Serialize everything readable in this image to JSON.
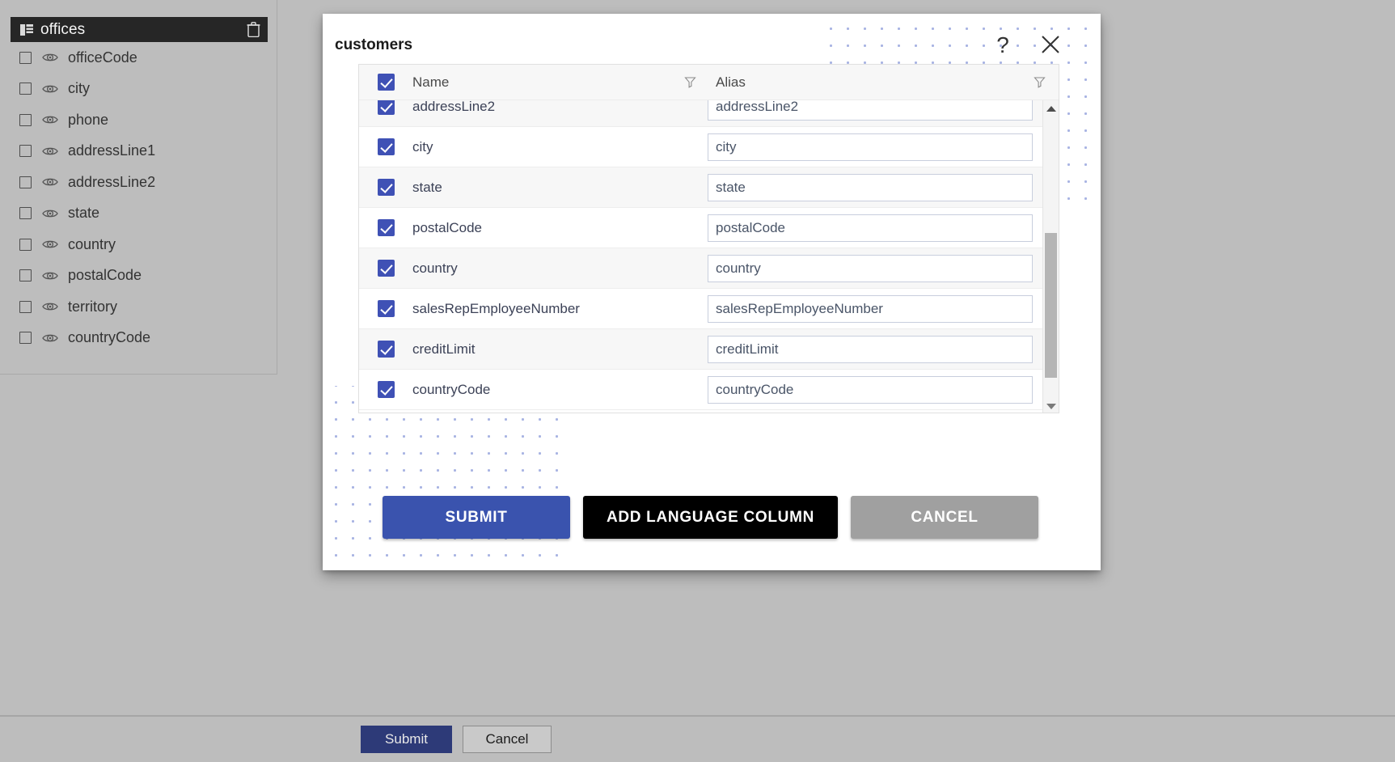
{
  "left_panel": {
    "table_title": "offices",
    "table_icon": "grid-icon",
    "delete_icon": "trash-icon",
    "fields": [
      {
        "label": "officeCode",
        "checked": false
      },
      {
        "label": "city",
        "checked": false
      },
      {
        "label": "phone",
        "checked": false
      },
      {
        "label": "addressLine1",
        "checked": false
      },
      {
        "label": "addressLine2",
        "checked": false
      },
      {
        "label": "state",
        "checked": false
      },
      {
        "label": "country",
        "checked": false
      },
      {
        "label": "postalCode",
        "checked": false
      },
      {
        "label": "territory",
        "checked": false
      },
      {
        "label": "countryCode",
        "checked": false
      }
    ]
  },
  "dialog": {
    "title": "customers",
    "help_icon": "?",
    "close_icon": "close-icon",
    "columns": {
      "name": "Name",
      "alias": "Alias",
      "filter_icon": "funnel-icon"
    },
    "header_checkbox_checked": true,
    "rows": [
      {
        "name": "addressLine2",
        "alias": "addressLine2",
        "checked": true
      },
      {
        "name": "city",
        "alias": "city",
        "checked": true
      },
      {
        "name": "state",
        "alias": "state",
        "checked": true
      },
      {
        "name": "postalCode",
        "alias": "postalCode",
        "checked": true
      },
      {
        "name": "country",
        "alias": "country",
        "checked": true
      },
      {
        "name": "salesRepEmployeeNumber",
        "alias": "salesRepEmployeeNumber",
        "checked": true
      },
      {
        "name": "creditLimit",
        "alias": "creditLimit",
        "checked": true
      },
      {
        "name": "countryCode",
        "alias": "countryCode",
        "checked": true
      }
    ],
    "buttons": {
      "submit": "SUBMIT",
      "add_language_column": "ADD LANGUAGE COLUMN",
      "cancel": "CANCEL"
    },
    "scrollbar": {
      "up_arrow_icon": "triangle-up-icon",
      "down_arrow_icon": "triangle-down-icon"
    }
  },
  "bottom_bar": {
    "submit": "Submit",
    "cancel": "Cancel"
  },
  "colors": {
    "accent_blue": "#3f51b5",
    "submit_blue": "#3a53ae",
    "bottom_submit_blue": "#2d3a78",
    "cancel_grey": "#a0a0a0",
    "black_button": "#000000",
    "page_background": "#bdbdbd",
    "panel_header": "#262626",
    "dot_pattern": "#a9b4e3"
  }
}
